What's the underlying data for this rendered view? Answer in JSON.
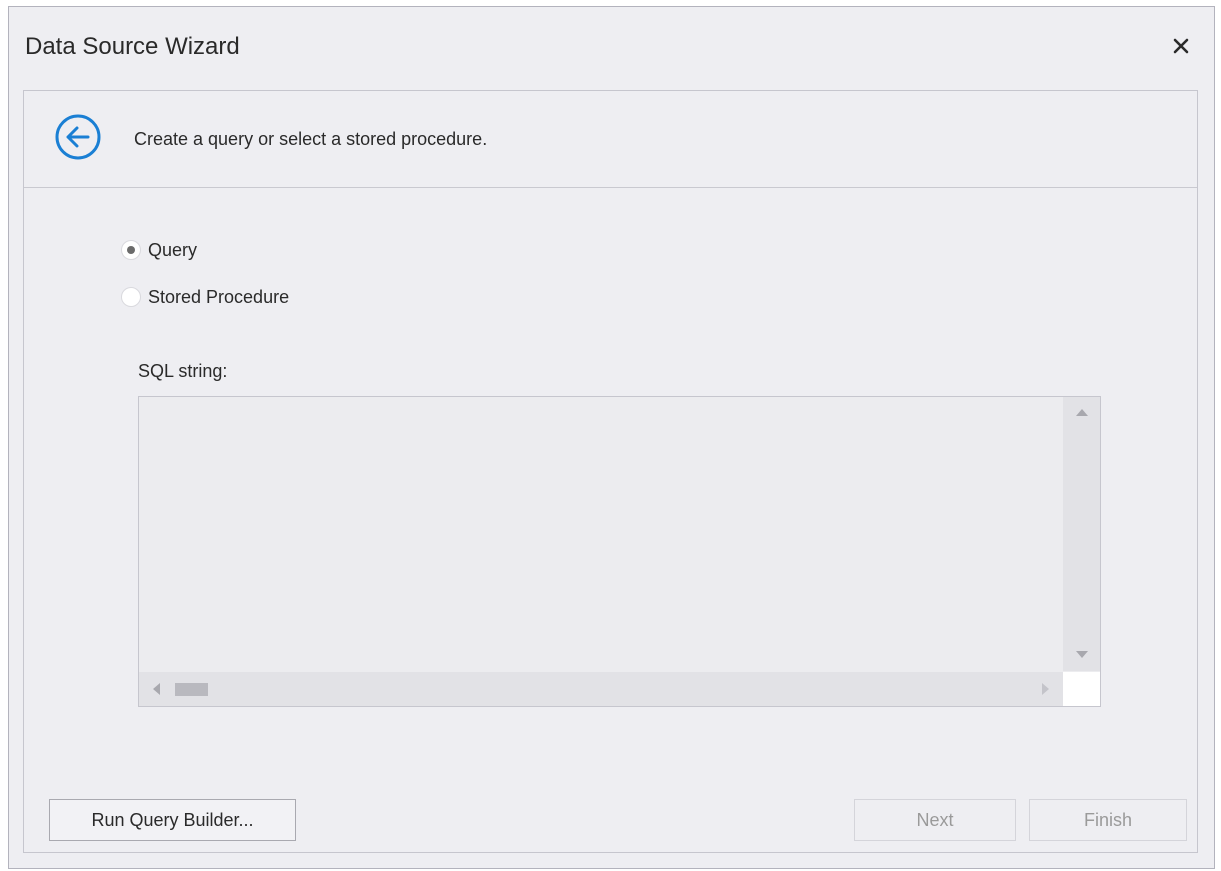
{
  "window": {
    "title": "Data Source Wizard"
  },
  "header": {
    "instruction": "Create a query or select a stored procedure."
  },
  "options": [
    {
      "label": "Query",
      "selected": true
    },
    {
      "label": "Stored Procedure",
      "selected": false
    }
  ],
  "sql": {
    "label": "SQL string:",
    "value": ""
  },
  "buttons": {
    "query_builder": "Run Query Builder...",
    "next": "Next",
    "finish": "Finish"
  },
  "icons": {
    "back": "back-arrow-circle-icon",
    "close": "close-icon"
  },
  "colors": {
    "accent": "#1a7fd4",
    "window_bg": "#eeeef2"
  }
}
